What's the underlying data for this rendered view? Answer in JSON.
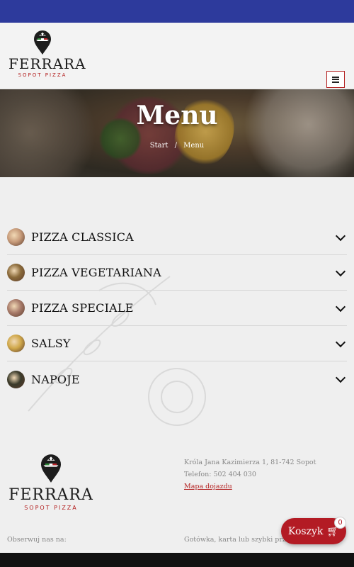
{
  "brand": {
    "name": "FERRARA",
    "tagline": "SOPOT PIZZA",
    "colors": {
      "topbar": "#2d3a9c",
      "accent": "#b32020",
      "cart": "#b31b24"
    }
  },
  "header": {
    "menu_icon": "hamburger-icon"
  },
  "hero": {
    "title": "Menu",
    "breadcrumb": {
      "home": "Start",
      "separator": "/",
      "current": "Menu"
    }
  },
  "categories": [
    {
      "label": "PIZZA CLASSICA",
      "thumb": "#c79b7a"
    },
    {
      "label": "PIZZA VEGETARIANA",
      "thumb": "#8a6a3a"
    },
    {
      "label": "PIZZA SPECIALE",
      "thumb": "#a87b6a"
    },
    {
      "label": "SALSY",
      "thumb": "#d0a84a"
    },
    {
      "label": "NAPOJE",
      "thumb": "#3a3a2a"
    }
  ],
  "footer": {
    "address": "Króla Jana Kazimierza 1, 81-742 Sopot",
    "phone": "Telefon: 502 404 030",
    "map_link": "Mapa dojazdu",
    "follow": "Obserwuj nas na:",
    "payment": "Gotówka, karta lub szybki przelew"
  },
  "cart": {
    "label": "Koszyk",
    "count": "0",
    "icon": "shopping-cart-icon"
  }
}
